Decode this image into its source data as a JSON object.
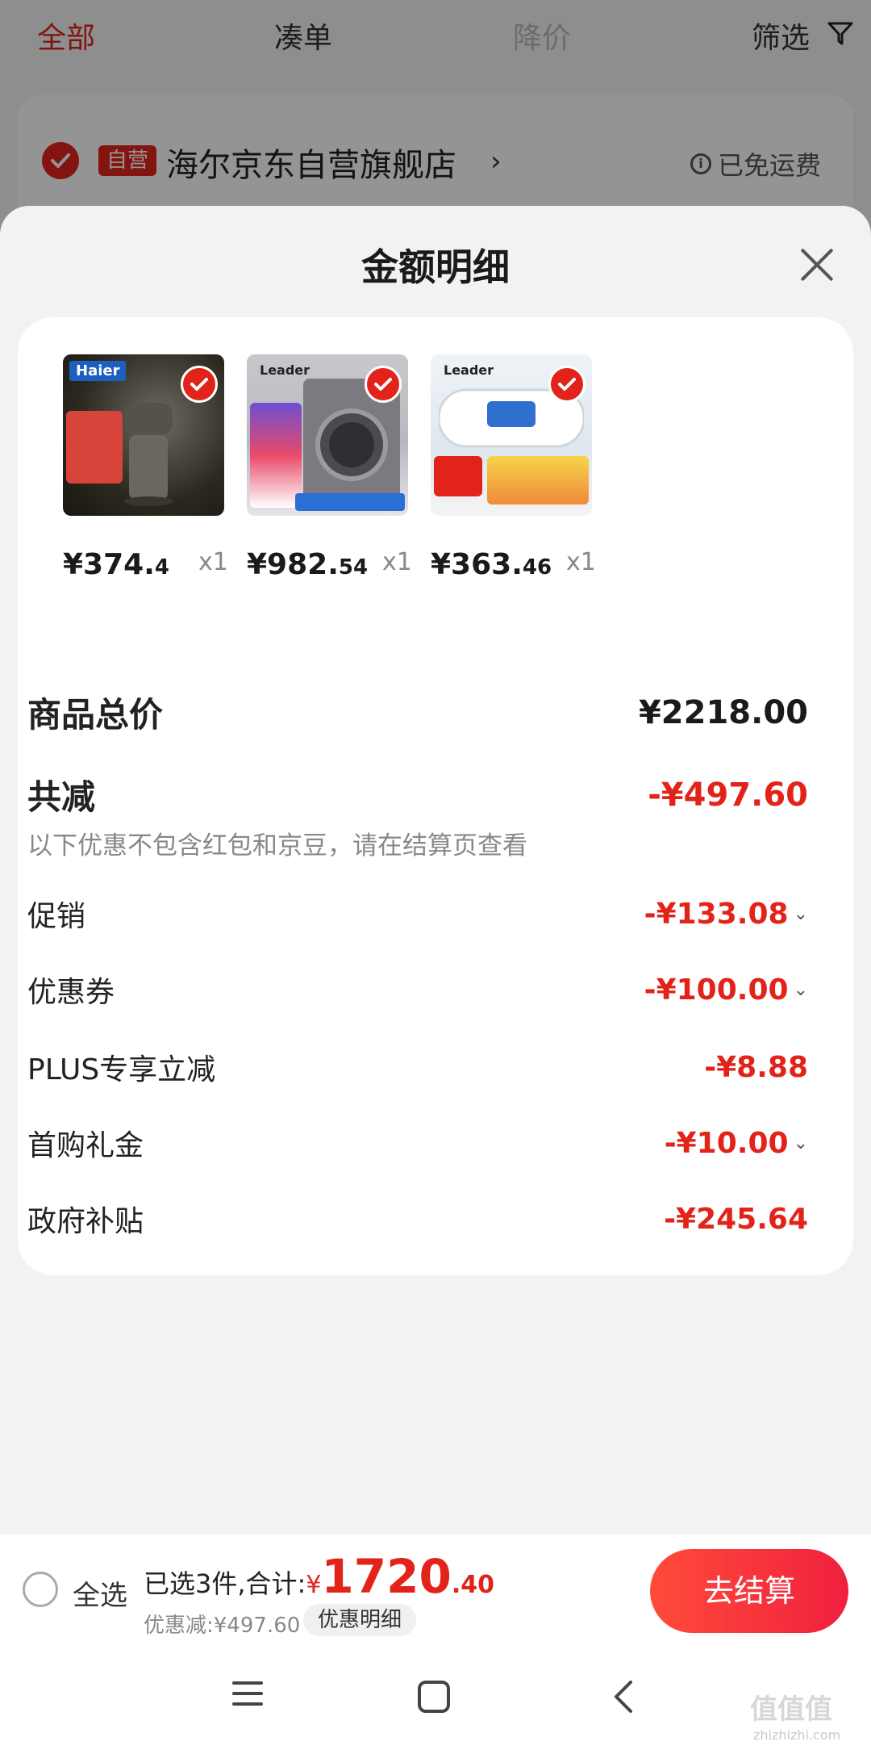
{
  "top_tabs": [
    {
      "label": "全部"
    },
    {
      "label": "凑单"
    },
    {
      "label": "降价"
    },
    {
      "label": "筛选"
    }
  ],
  "store": {
    "badge": "自营",
    "name": "海尔京东自营旗舰店",
    "shipping": "已免运费"
  },
  "sheet": {
    "title": "金额明细"
  },
  "products": [
    {
      "brand": "Haier",
      "price_int": "¥374.",
      "price_dec": "4",
      "qty": "x1"
    },
    {
      "brand": "Leader",
      "price_int": "¥982.",
      "price_dec": "54",
      "qty": "x1"
    },
    {
      "brand": "Leader",
      "price_int": "¥363.",
      "price_dec": "46",
      "qty": "x1"
    }
  ],
  "amounts": {
    "total_label": "商品总价",
    "total_value": "¥2218.00",
    "reduce_label": "共减",
    "reduce_value": "-¥497.60",
    "note": "以下优惠不包含红包和京豆，请在结算页查看",
    "items": [
      {
        "label": "促销",
        "value": "-¥133.08",
        "expandable": true
      },
      {
        "label": "优惠券",
        "value": "-¥100.00",
        "expandable": true
      },
      {
        "label": "PLUS专享立减",
        "value": "-¥8.88",
        "expandable": false
      },
      {
        "label": "首购礼金",
        "value": "-¥10.00",
        "expandable": true
      },
      {
        "label": "政府补贴",
        "value": "-¥245.64",
        "expandable": false
      }
    ]
  },
  "bottom": {
    "select_all": "全选",
    "selected_text": "已选3件,合计:",
    "currency": "¥",
    "amount_int": "1720",
    "amount_dec": ".40",
    "discount": "优惠减:¥497.60",
    "detail_chip": "优惠明细",
    "checkout": "去结算"
  },
  "watermark": {
    "main": "值值值",
    "sub": "zhizhizhi.com"
  },
  "colors": {
    "accent": "#e2231a",
    "sheet_bg": "#f2f2f4",
    "card_bg": "#ffffff"
  }
}
